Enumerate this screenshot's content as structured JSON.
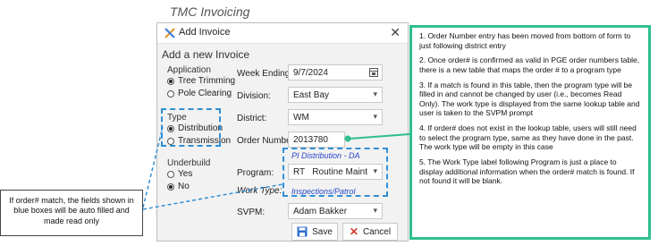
{
  "caption": "TMC Invoicing",
  "dialog": {
    "title": "Add Invoice",
    "close_glyph": "✕",
    "heading": "Add a new Invoice",
    "application": {
      "label": "Application",
      "options": [
        "Tree Trimming",
        "Pole Clearing"
      ],
      "selected": 0
    },
    "type": {
      "label": "Type",
      "options": [
        "Distribution",
        "Transmission"
      ],
      "selected": 0
    },
    "underbuild": {
      "label": "Underbuild",
      "options": [
        "Yes",
        "No"
      ],
      "selected": 1
    },
    "fields": {
      "week_ending_label": "Week Ending:",
      "week_ending_value": "9/7/2024",
      "division_label": "Division:",
      "division_value": "East Bay",
      "district_label": "District:",
      "district_value": "WM",
      "order_number_label": "Order Number:",
      "order_number_value": "2013780",
      "pi_text": "PI Distribution - DA",
      "program_label": "Program:",
      "program_value": "RT   Routine Maint",
      "work_type_label": "Work Type:",
      "work_type_value": "Inspections/Patrol",
      "svpm_label": "SVPM:",
      "svpm_value": "Adam Bakker"
    },
    "buttons": {
      "save": "Save",
      "cancel": "Cancel"
    }
  },
  "note_left": "If order# match, the fields shown in blue boxes will be auto filled and made read only",
  "notes": [
    "1.  Order Number entry has been moved from bottom of form to just following district entry",
    "2.  Once order# is confirmed as valid in PGE order numbers table, there is a new table that maps the order # to a program type",
    "3.  If a match is found in this table, then the program type will be filled in and cannot be changed by user (i.e., becomes Read Only).  The work type is displayed from the same lookup table and user is taken to the SVPM prompt",
    "4.  If order# does not exist in the lookup table, users will still need to select the program type, same as they have done in the past.  The work type will be empty in this case",
    "5.  The Work Type label following Program is just a place to display additional information when the order# match is found.  If not found it will be blank."
  ],
  "colors": {
    "dash_blue": "#2f8fd6",
    "note_border": "#2fbf8f",
    "info_text": "#2b47c9",
    "save_icon": "#2f6fd0",
    "cancel_icon": "#d23a2a"
  }
}
